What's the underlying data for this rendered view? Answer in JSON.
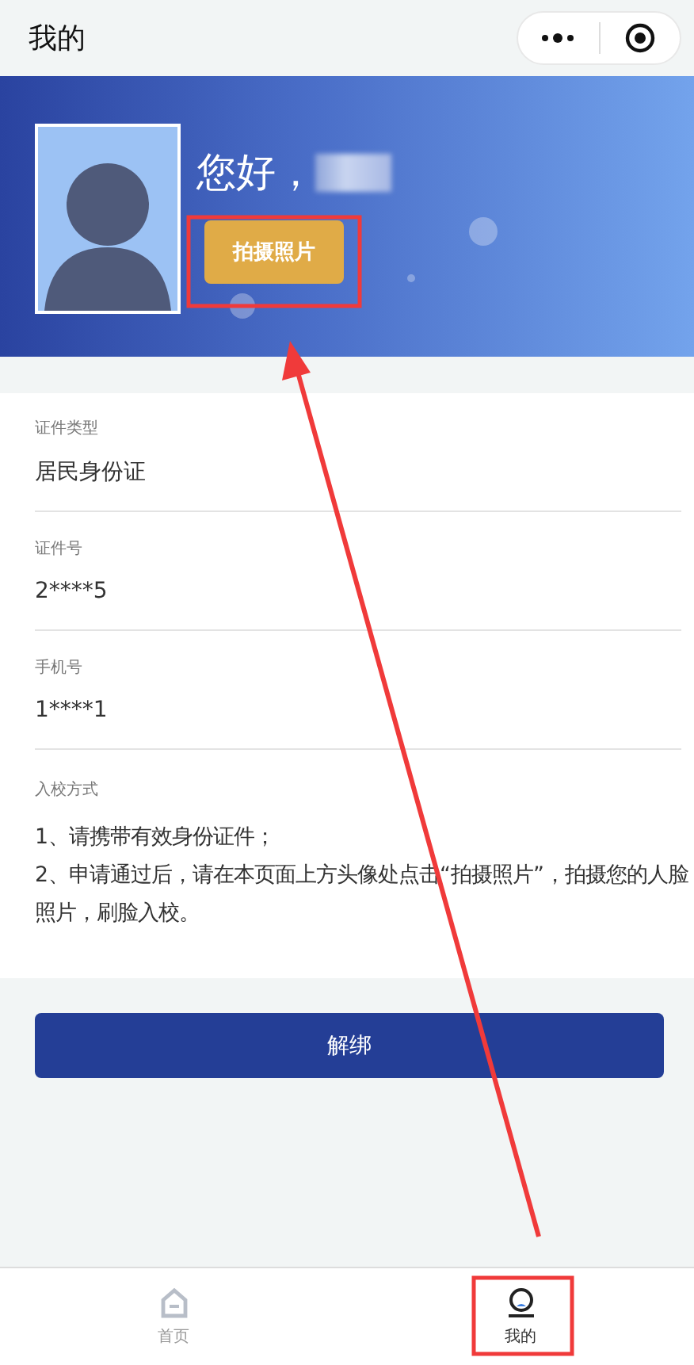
{
  "nav_bar": {
    "title": "我的"
  },
  "profile": {
    "greeting": "您好，",
    "name_redacted": true,
    "photo_button": "拍摄照片"
  },
  "fields": [
    {
      "label": "证件类型",
      "value": "居民身份证"
    },
    {
      "label": "证件号",
      "value": "2****5"
    },
    {
      "label": "手机号",
      "value": "1****1"
    }
  ],
  "entry_method": {
    "label": "入校方式",
    "lines": [
      "1、请携带有效身份证件；",
      "2、申请通过后，请在本页面上方头像处点击“拍摄照片”，拍摄您的人脸照片，刷脸入校。"
    ]
  },
  "unbind_button": "解绑",
  "tab_bar": [
    {
      "label": "首页",
      "kind": "home",
      "selected": false
    },
    {
      "label": "我的",
      "kind": "profile",
      "selected": true
    }
  ]
}
